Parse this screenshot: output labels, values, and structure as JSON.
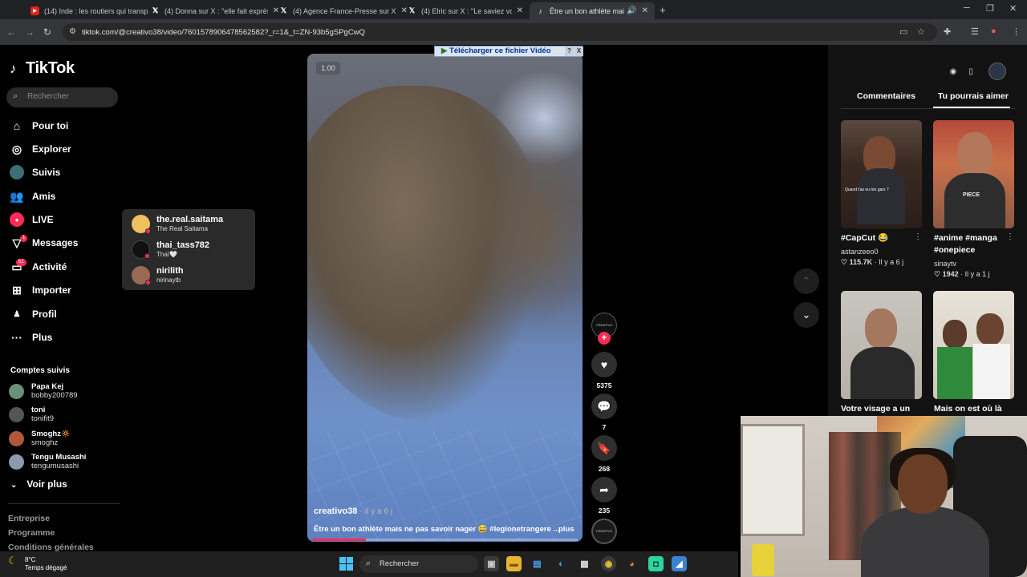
{
  "browser": {
    "tabs": [
      {
        "icon": "youtube-icon",
        "title": "(14) Inde : les routiers qui transpo"
      },
      {
        "icon": "x-icon",
        "title": "(4) Donna sur X : \"elle fait exprès"
      },
      {
        "icon": "x-icon",
        "title": "(4) Agence France-Presse sur X :"
      },
      {
        "icon": "x-icon",
        "title": "(4) Elric sur X : \"Le saviez vous?"
      },
      {
        "icon": "tiktok-icon",
        "title": "Être un bon athlète mais ne pas"
      }
    ],
    "url": "tiktok.com/@creativo38/video/7601578906478562582?_r=1&_t=ZN-93b5gSPgCwQ"
  },
  "sidebar": {
    "logo": "TikTok",
    "search_placeholder": "Rechercher",
    "nav": [
      {
        "label": "Pour toi",
        "icon": "home-icon"
      },
      {
        "label": "Explorer",
        "icon": "compass-icon"
      },
      {
        "label": "Suivis",
        "icon": "following-avatar-icon"
      },
      {
        "label": "Amis",
        "icon": "friends-icon"
      },
      {
        "label": "LIVE",
        "icon": "live-icon"
      },
      {
        "label": "Messages",
        "icon": "messages-icon",
        "badge": "1"
      },
      {
        "label": "Activité",
        "icon": "activity-icon",
        "badge": "51"
      },
      {
        "label": "Importer",
        "icon": "upload-icon"
      },
      {
        "label": "Profil",
        "icon": "profile-icon"
      },
      {
        "label": "Plus",
        "icon": "more-icon"
      }
    ],
    "followed_title": "Comptes suivis",
    "followed": [
      {
        "name": "Papa Kej",
        "handle": "bobby200789"
      },
      {
        "name": "toni",
        "handle": "tonifit9"
      },
      {
        "name": "Smoghz🔅",
        "handle": "smoghz"
      },
      {
        "name": "Tengu Musashi",
        "handle": "tengumusashi"
      }
    ],
    "see_more": "Voir plus",
    "footer": [
      "Entreprise",
      "Programme",
      "Conditions générales"
    ]
  },
  "live_popup": [
    {
      "user": "the.real.saitama",
      "name": "The Real Saitama"
    },
    {
      "user": "thai_tass782",
      "name": "Thaï🤍"
    },
    {
      "user": "nirilith",
      "name": "nirinaytb"
    }
  ],
  "video": {
    "speed": "1.00",
    "download_bar": "Télécharger ce fichier Vidéo",
    "download_help": "?",
    "download_close": "X",
    "author": "creativo38",
    "time": "· Il y a 6 j",
    "caption": "Être un bon athlète mais ne pas savoir nager 😅 #legionetrangere ...",
    "more": "plus",
    "progress": 0.2,
    "creator_label": "CREATIVO",
    "likes": "5375",
    "comments": "7",
    "saves": "268",
    "shares": "235"
  },
  "right_panel": {
    "tab_comments": "Commentaires",
    "tab_suggest": "Tu pourrais aimer",
    "items": [
      {
        "title": "#CapCut 😂",
        "user": "astanzeeo0",
        "likes": "115.7K",
        "time": "· Il y a 6 j"
      },
      {
        "title": "#anime #manga #onepiece",
        "user": "sinaytv",
        "likes": "1942",
        "time": "· Il y a 1 j"
      },
      {
        "title": "Votre visage a un",
        "user": "",
        "likes": "",
        "time": ""
      },
      {
        "title": "Mais on est où là",
        "user": "",
        "likes": "",
        "time": ""
      }
    ],
    "thumb_captions": [
      "Quand t'as eu ton gars ?",
      "PIECE"
    ]
  },
  "taskbar": {
    "temp": "8°C",
    "weather": "Temps dégagé",
    "search": "Rechercher"
  },
  "colors": {
    "accent": "#fe2c55",
    "background": "#000000",
    "panel": "#121212"
  }
}
